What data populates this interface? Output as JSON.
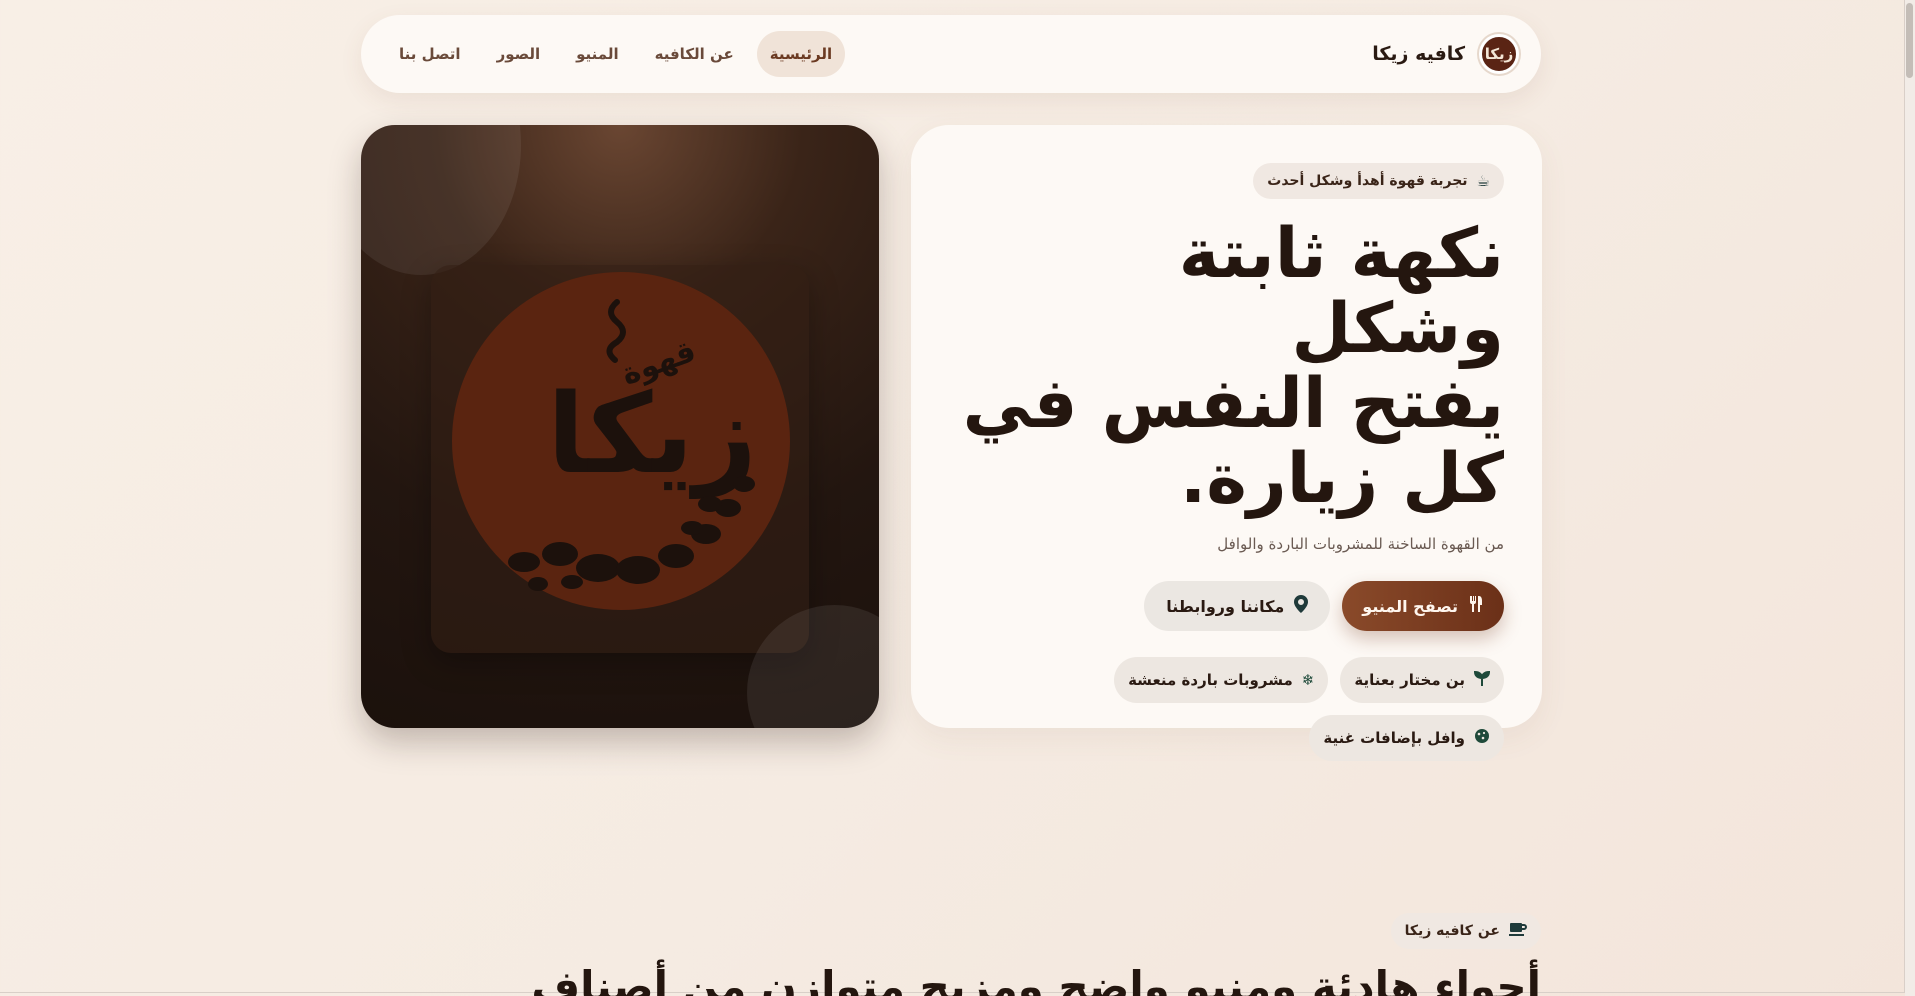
{
  "brand": {
    "name": "كافيه زيكا",
    "logo_text": "زيكا"
  },
  "nav": {
    "links": [
      {
        "label": "الرئيسية",
        "active": true
      },
      {
        "label": "عن الكافيه",
        "active": false
      },
      {
        "label": "المنيو",
        "active": false
      },
      {
        "label": "الصور",
        "active": false
      },
      {
        "label": "اتصل بنا",
        "active": false
      }
    ]
  },
  "hero": {
    "badge": "تجربة قهوة أهدأ وشكل أحدث",
    "title_lines": [
      "نكهة ثابتة وشكل",
      "يفتح النفس في",
      "كل زيارة."
    ],
    "subtitle": "من القهوة الساخنة للمشروبات الباردة والوافل",
    "primary_button": "تصفح المنيو",
    "secondary_button": "مكاننا وروابطنا",
    "features": [
      {
        "label": "بن مختار بعناية",
        "icon": "sprout-icon"
      },
      {
        "label": "مشروبات باردة منعشة",
        "icon": "snowflake-icon"
      },
      {
        "label": "وافل بإضافات غنية",
        "icon": "cookie-icon"
      }
    ]
  },
  "logo_art": {
    "word_main": "زيكا",
    "word_small": "قهوة"
  },
  "about": {
    "badge": "عن كافيه زيكا",
    "heading": "أجواء هادئة ومنيو واضح ومزيج متوازن من أصناف"
  },
  "colors": {
    "accent": "#7a3c1e",
    "background": "#f6ece3",
    "card": "#fdf9f5",
    "logo_disc": "#5a2410"
  }
}
